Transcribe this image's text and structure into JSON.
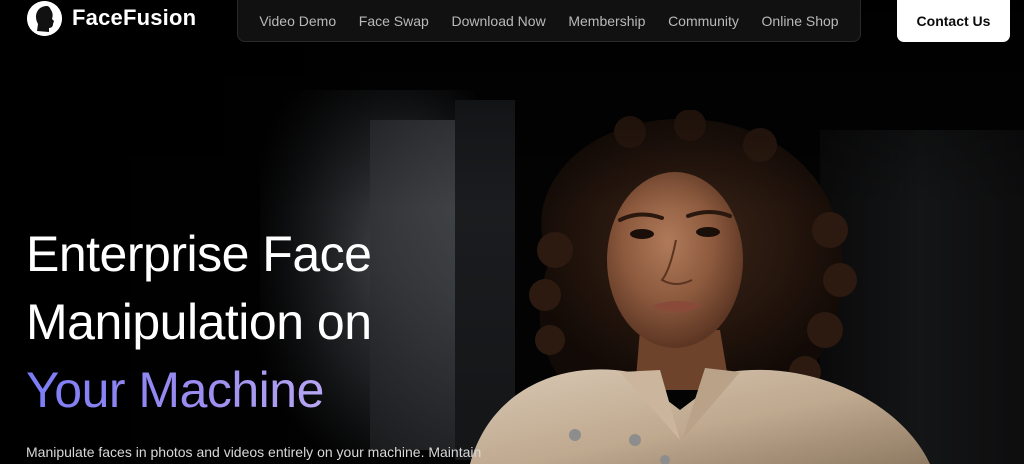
{
  "brand": {
    "name": "FaceFusion",
    "logo_icon": "face-profile-logo-icon"
  },
  "nav": {
    "items": [
      {
        "label": "Video Demo"
      },
      {
        "label": "Face Swap"
      },
      {
        "label": "Download Now"
      },
      {
        "label": "Membership"
      },
      {
        "label": "Community"
      },
      {
        "label": "Online Shop"
      }
    ]
  },
  "header": {
    "contact_label": "Contact Us"
  },
  "hero": {
    "title_line1": "Enterprise Face",
    "title_line2": "Manipulation on",
    "title_line3": "Your Machine",
    "subtitle": "Manipulate faces in photos and videos entirely on your machine. Maintain"
  },
  "colors": {
    "background": "#030303",
    "accent_gradient_start": "#7b7cf6",
    "accent_gradient_end": "#b7a7f2",
    "nav_text": "#b9b9b9",
    "button_bg": "#ffffff"
  }
}
